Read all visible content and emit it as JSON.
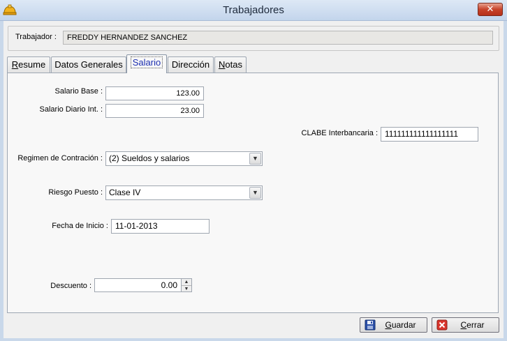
{
  "window": {
    "title": "Trabajadores",
    "close_label": "✕"
  },
  "header": {
    "worker_label": "Trabajador :",
    "worker_value": "FREDDY HERNANDEZ SANCHEZ"
  },
  "tabs": [
    {
      "label": "Resume",
      "underline": "R",
      "rest": "esume"
    },
    {
      "label": "Datos Generales"
    },
    {
      "label": "Salario",
      "active": true
    },
    {
      "label": "Dirección"
    },
    {
      "label": "Notas",
      "underline": "N",
      "rest": "otas"
    }
  ],
  "salario": {
    "base_label": "Salario Base :",
    "base_value": "123.00",
    "diario_label": "Salario Diario Int. :",
    "diario_value": "23.00",
    "clabe_label": "CLABE Interbancaria :",
    "clabe_value": "111111111111111111",
    "regimen_label": "Regimen de Contración :",
    "regimen_value": "(2) Sueldos y salarios",
    "riesgo_label": "Riesgo Puesto :",
    "riesgo_value": "Clase IV",
    "fecha_label": "Fecha de Inicio :",
    "fecha_value": "11-01-2013",
    "descuento_label": "Descuento :",
    "descuento_value": "0.00"
  },
  "buttons": {
    "save": {
      "underline": "G",
      "rest": "uardar"
    },
    "close": {
      "underline": "C",
      "rest": "errar"
    }
  },
  "colors": {
    "accent": "#1d2fb0",
    "panel": "#f8f8f8",
    "frame": "#c9d8ea"
  }
}
